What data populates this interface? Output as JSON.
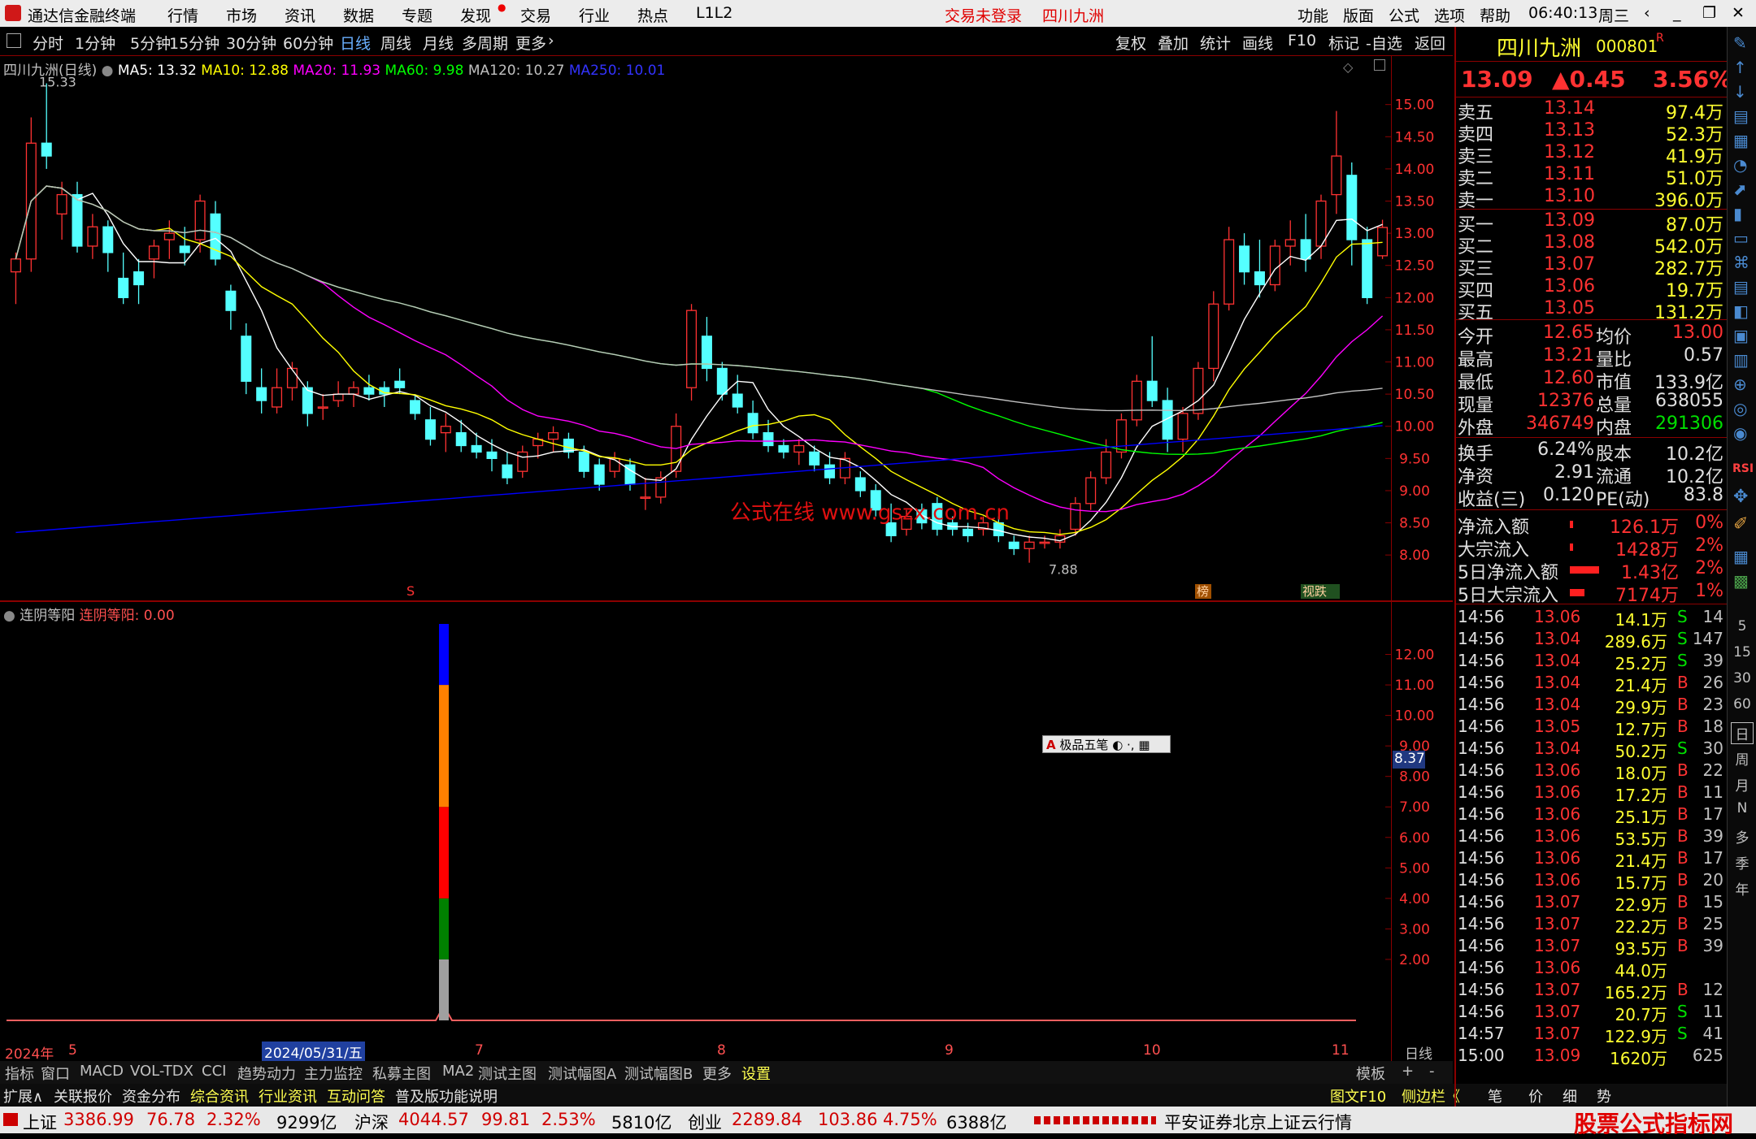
{
  "titlebar": {
    "app_title": "通达信金融终端",
    "menu": [
      "行情",
      "市场",
      "资讯",
      "数据",
      "专题",
      "发现",
      "交易",
      "行业",
      "热点",
      "L1L2"
    ],
    "login_status": "交易未登录",
    "stock_name": "四川九洲",
    "right_menu": [
      "功能",
      "版面",
      "公式",
      "选项",
      "帮助"
    ],
    "time": "06:40:13",
    "weekday": "周三"
  },
  "periods": [
    "分时",
    "1分钟",
    "5分钟",
    "15分钟",
    "30分钟",
    "60分钟",
    "日线",
    "周线",
    "月线",
    "多周期",
    "更多"
  ],
  "active_period": "日线",
  "tools": [
    "复权",
    "叠加",
    "统计",
    "画线",
    "F10",
    "标记",
    "-自选",
    "返回"
  ],
  "chart_legend": {
    "title": "四川九洲(日线)",
    "ma5": "MA5: 13.32",
    "ma10": "MA10: 12.88",
    "ma20": "MA20: 11.93",
    "ma60": "MA60: 9.98",
    "ma120": "MA120: 10.27",
    "ma250": "MA250: 10.01",
    "high_mark": "15.33",
    "low_mark": "7.88",
    "watermark": "公式在线  www.gszx.com.cn",
    "tag_s": "S",
    "tag_bang": "榜",
    "tag_jg": "视跌"
  },
  "indicator_legend": {
    "name": "连阴等阳",
    "value": "连阴等阳: 0.00",
    "current": "8.37",
    "ime_label": "极品五笔"
  },
  "chart_data": [
    {
      "type": "candlestick",
      "title": "四川九洲(日线)",
      "y_ticks": [
        "15.00",
        "14.50",
        "14.00",
        "13.50",
        "13.00",
        "12.50",
        "12.00",
        "11.50",
        "11.00",
        "10.50",
        "10.00",
        "9.50",
        "9.00",
        "8.50",
        "8.00"
      ],
      "ylim": [
        7.8,
        15.4
      ],
      "candles": [
        [
          12.4,
          12.7,
          11.9,
          12.6
        ],
        [
          12.6,
          14.8,
          12.4,
          14.4
        ],
        [
          14.4,
          15.33,
          14.0,
          14.2
        ],
        [
          13.3,
          13.8,
          12.9,
          13.6
        ],
        [
          13.6,
          13.8,
          12.7,
          12.8
        ],
        [
          12.8,
          13.3,
          12.6,
          13.1
        ],
        [
          13.1,
          13.2,
          12.4,
          12.7
        ],
        [
          12.3,
          12.7,
          11.9,
          12.0
        ],
        [
          12.4,
          12.6,
          11.9,
          12.2
        ],
        [
          12.6,
          12.9,
          12.3,
          12.8
        ],
        [
          12.9,
          13.2,
          12.6,
          13.0
        ],
        [
          12.8,
          13.1,
          12.5,
          12.7
        ],
        [
          12.9,
          13.6,
          12.7,
          13.5
        ],
        [
          13.3,
          13.5,
          12.5,
          12.6
        ],
        [
          12.1,
          12.2,
          11.5,
          11.8
        ],
        [
          11.4,
          11.6,
          10.5,
          10.7
        ],
        [
          10.6,
          10.9,
          10.2,
          10.4
        ],
        [
          10.3,
          10.9,
          10.2,
          10.6
        ],
        [
          10.6,
          11.0,
          10.4,
          10.9
        ],
        [
          10.6,
          10.7,
          10.0,
          10.2
        ],
        [
          10.3,
          10.5,
          10.1,
          10.3
        ],
        [
          10.4,
          10.7,
          10.3,
          10.5
        ],
        [
          10.5,
          10.7,
          10.3,
          10.6
        ],
        [
          10.6,
          10.8,
          10.4,
          10.5
        ],
        [
          10.6,
          10.7,
          10.3,
          10.5
        ],
        [
          10.7,
          10.9,
          10.5,
          10.6
        ],
        [
          10.4,
          10.5,
          10.1,
          10.2
        ],
        [
          10.1,
          10.3,
          9.7,
          9.8
        ],
        [
          9.9,
          10.2,
          9.6,
          10.0
        ],
        [
          9.9,
          10.1,
          9.6,
          9.7
        ],
        [
          9.7,
          9.9,
          9.5,
          9.6
        ],
        [
          9.6,
          9.8,
          9.3,
          9.5
        ],
        [
          9.4,
          9.6,
          9.1,
          9.2
        ],
        [
          9.3,
          9.7,
          9.2,
          9.6
        ],
        [
          9.7,
          9.9,
          9.5,
          9.8
        ],
        [
          9.8,
          10.0,
          9.6,
          9.9
        ],
        [
          9.8,
          9.9,
          9.5,
          9.6
        ],
        [
          9.6,
          9.7,
          9.2,
          9.3
        ],
        [
          9.4,
          9.5,
          9.0,
          9.1
        ],
        [
          9.3,
          9.6,
          9.2,
          9.5
        ],
        [
          9.4,
          9.5,
          9.0,
          9.1
        ],
        [
          8.9,
          9.2,
          8.7,
          8.9
        ],
        [
          8.9,
          9.3,
          8.8,
          9.2
        ],
        [
          9.3,
          10.2,
          9.2,
          10.0
        ],
        [
          10.6,
          11.9,
          10.4,
          11.8
        ],
        [
          11.4,
          11.7,
          10.7,
          10.9
        ],
        [
          10.9,
          11.0,
          10.4,
          10.5
        ],
        [
          10.5,
          10.8,
          10.2,
          10.3
        ],
        [
          10.2,
          10.4,
          9.8,
          9.9
        ],
        [
          9.9,
          10.1,
          9.6,
          9.7
        ],
        [
          9.7,
          9.8,
          9.5,
          9.6
        ],
        [
          9.6,
          9.8,
          9.4,
          9.7
        ],
        [
          9.6,
          9.7,
          9.3,
          9.4
        ],
        [
          9.4,
          9.6,
          9.1,
          9.2
        ],
        [
          9.2,
          9.6,
          9.1,
          9.5
        ],
        [
          9.2,
          9.3,
          8.9,
          9.0
        ],
        [
          9.0,
          9.1,
          8.6,
          8.7
        ],
        [
          8.5,
          8.8,
          8.2,
          8.3
        ],
        [
          8.4,
          8.7,
          8.3,
          8.6
        ],
        [
          8.7,
          8.8,
          8.4,
          8.5
        ],
        [
          8.8,
          8.9,
          8.3,
          8.4
        ],
        [
          8.5,
          8.6,
          8.3,
          8.4
        ],
        [
          8.4,
          8.5,
          8.2,
          8.3
        ],
        [
          8.4,
          8.6,
          8.3,
          8.5
        ],
        [
          8.5,
          8.6,
          8.2,
          8.3
        ],
        [
          8.2,
          8.3,
          8.0,
          8.1
        ],
        [
          8.1,
          8.3,
          7.88,
          8.2
        ],
        [
          8.2,
          8.3,
          8.1,
          8.2
        ],
        [
          8.2,
          8.4,
          8.1,
          8.3
        ],
        [
          8.4,
          8.9,
          8.3,
          8.8
        ],
        [
          8.8,
          9.3,
          8.7,
          9.2
        ],
        [
          9.2,
          9.8,
          9.1,
          9.6
        ],
        [
          9.6,
          10.2,
          9.5,
          10.1
        ],
        [
          10.1,
          10.8,
          10.0,
          10.7
        ],
        [
          10.7,
          11.4,
          10.3,
          10.4
        ],
        [
          10.4,
          10.6,
          9.6,
          9.8
        ],
        [
          9.8,
          10.3,
          9.6,
          10.2
        ],
        [
          10.2,
          11.0,
          10.1,
          10.9
        ],
        [
          10.9,
          12.1,
          10.7,
          11.9
        ],
        [
          11.9,
          13.1,
          11.8,
          12.9
        ],
        [
          12.8,
          13.0,
          12.2,
          12.4
        ],
        [
          12.4,
          12.9,
          12.0,
          12.2
        ],
        [
          12.2,
          12.9,
          12.1,
          12.8
        ],
        [
          12.8,
          13.2,
          12.5,
          12.9
        ],
        [
          12.9,
          13.3,
          12.4,
          12.6
        ],
        [
          12.8,
          13.6,
          12.6,
          13.5
        ],
        [
          13.6,
          14.9,
          13.3,
          14.2
        ],
        [
          13.9,
          14.1,
          12.5,
          12.9
        ],
        [
          12.9,
          13.1,
          11.9,
          12.0
        ],
        [
          12.65,
          13.21,
          12.6,
          13.09
        ]
      ]
    },
    {
      "type": "bar",
      "title": "连阴等阳",
      "y_ticks": [
        "12.00",
        "11.00",
        "10.00",
        "9.00",
        "8.00",
        "7.00",
        "6.00",
        "5.00",
        "4.00",
        "3.00",
        "2.00"
      ],
      "ylim": [
        0,
        13
      ],
      "x_labels": [
        "2024年",
        "5",
        "2024/05/31/五",
        "7",
        "8",
        "9",
        "10",
        "11"
      ],
      "series": [
        {
          "name": "连阴等阳",
          "spike_height": 13
        }
      ]
    }
  ],
  "quote": {
    "name": "四川九洲",
    "code": "000801",
    "price": "13.09",
    "change": "▲0.45",
    "pct": "3.56%",
    "asks": [
      [
        "卖五",
        "13.14",
        "97.4万"
      ],
      [
        "卖四",
        "13.13",
        "52.3万"
      ],
      [
        "卖三",
        "13.12",
        "41.9万"
      ],
      [
        "卖二",
        "13.11",
        "51.0万"
      ],
      [
        "卖一",
        "13.10",
        "396.0万"
      ]
    ],
    "bids": [
      [
        "买一",
        "13.09",
        "87.0万"
      ],
      [
        "买二",
        "13.08",
        "542.0万"
      ],
      [
        "买三",
        "13.07",
        "282.7万"
      ],
      [
        "买四",
        "13.06",
        "19.7万"
      ],
      [
        "买五",
        "13.05",
        "131.2万"
      ]
    ],
    "stats": [
      [
        "今开",
        "12.65",
        "均价",
        "13.00"
      ],
      [
        "最高",
        "13.21",
        "量比",
        "0.57"
      ],
      [
        "最低",
        "12.60",
        "市值",
        "133.9亿"
      ],
      [
        "现量",
        "12376",
        "总量",
        "638055"
      ],
      [
        "外盘",
        "346749",
        "内盘",
        "291306"
      ]
    ],
    "finance": [
      [
        "换手",
        "6.24%",
        "股本",
        "10.2亿"
      ],
      [
        "净资",
        "2.91",
        "流通",
        "10.2亿"
      ],
      [
        "收益(三)",
        "0.120",
        "PE(动)",
        "83.8"
      ]
    ],
    "flows": [
      [
        "净流入额",
        "126.1万",
        "0%"
      ],
      [
        "大宗流入",
        "1428万",
        "2%"
      ],
      [
        "5日净流入额",
        "1.43亿",
        "2%"
      ],
      [
        "5日大宗流入",
        "7174万",
        "1%"
      ]
    ],
    "ticks": [
      [
        "14:56",
        "13.06",
        "14.1万",
        "S",
        "14"
      ],
      [
        "14:56",
        "13.04",
        "289.6万",
        "S",
        "147"
      ],
      [
        "14:56",
        "13.04",
        "25.2万",
        "S",
        "39"
      ],
      [
        "14:56",
        "13.04",
        "21.4万",
        "B",
        "26"
      ],
      [
        "14:56",
        "13.04",
        "29.9万",
        "B",
        "23"
      ],
      [
        "14:56",
        "13.05",
        "12.7万",
        "B",
        "18"
      ],
      [
        "14:56",
        "13.04",
        "50.2万",
        "S",
        "30"
      ],
      [
        "14:56",
        "13.06",
        "18.0万",
        "B",
        "22"
      ],
      [
        "14:56",
        "13.06",
        "17.2万",
        "B",
        "11"
      ],
      [
        "14:56",
        "13.06",
        "25.1万",
        "B",
        "17"
      ],
      [
        "14:56",
        "13.06",
        "53.5万",
        "B",
        "39"
      ],
      [
        "14:56",
        "13.06",
        "21.4万",
        "B",
        "17"
      ],
      [
        "14:56",
        "13.06",
        "15.7万",
        "B",
        "20"
      ],
      [
        "14:56",
        "13.07",
        "22.9万",
        "B",
        "15"
      ],
      [
        "14:56",
        "13.07",
        "22.2万",
        "B",
        "25"
      ],
      [
        "14:56",
        "13.07",
        "93.5万",
        "B",
        "39"
      ],
      [
        "14:56",
        "13.06",
        "44.0万",
        "",
        ""
      ],
      [
        "14:56",
        "13.07",
        "165.2万",
        "B",
        "12"
      ],
      [
        "14:56",
        "13.07",
        "20.7万",
        "S",
        "11"
      ],
      [
        "14:57",
        "13.07",
        "122.9万",
        "S",
        "41"
      ],
      [
        "15:00",
        "13.09",
        "1620万",
        "",
        "625"
      ]
    ]
  },
  "side_icons": [
    "5",
    "15",
    "30",
    "60",
    "日",
    "周",
    "月",
    "N",
    "多",
    "季",
    "年"
  ],
  "datebar": {
    "left": "2024年",
    "m5": "5",
    "sel": "2024/05/31/五",
    "m7": "7",
    "m8": "8",
    "m9": "9",
    "m10": "10",
    "m11": "11",
    "right": "日线"
  },
  "tabs1": [
    "指标",
    "窗口",
    "MACD",
    "VOL-TDX",
    "CCI",
    "趋势动力",
    "主力监控",
    "私募主图",
    "MA2",
    "测试主图",
    "测试幅图A",
    "测试幅图B",
    "更多",
    "设置"
  ],
  "tabs1_right": [
    "模板",
    "+",
    "-"
  ],
  "tabs2": [
    "扩展∧",
    "关联报价",
    "资金分布",
    "综合资讯",
    "行业资讯",
    "互动问答",
    "普及版功能说明"
  ],
  "tabs2_right": [
    "图文F10",
    "侧边栏《",
    "笔",
    "价",
    "细",
    "势"
  ],
  "status": {
    "sh_name": "上证",
    "sh": "3386.99",
    "sh_chg": "76.78",
    "sh_pct": "2.32%",
    "sh_amt": "9299亿",
    "sz_name": "沪深",
    "sz": "4044.57",
    "sz_chg": "99.81",
    "sz_pct": "2.53%",
    "sz_amt": "5810亿",
    "cy_name": "创业",
    "cy": "2289.84",
    "cy_chg": "103.86",
    "cy_pct": "4.75%",
    "cy_amt": "6388亿",
    "broker": "平安证券北京上证云行情",
    "watermark": "股票公式指标网",
    "watermark_url": "www.gszx.com.cn"
  },
  "colors": {
    "up": "#ff3232",
    "down": "#54ffff",
    "ma5": "#ffffff",
    "ma10": "#ffff00",
    "ma20": "#ff00ff",
    "ma60": "#00ff00",
    "ma120": "#c0c0c0",
    "ma250": "#0000ff"
  }
}
